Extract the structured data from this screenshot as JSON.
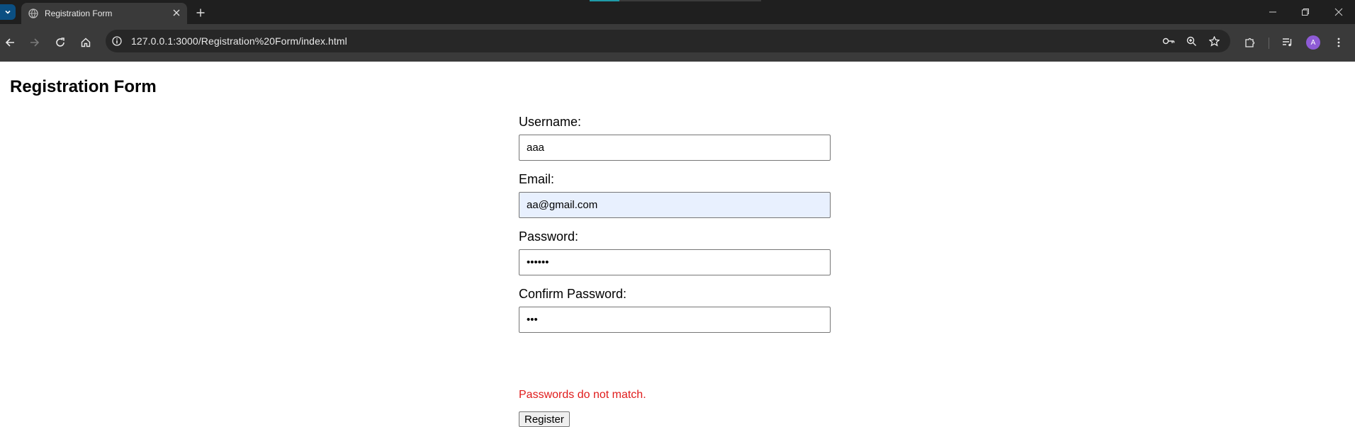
{
  "browser": {
    "tab_title": "Registration Form",
    "url": "127.0.0.1:3000/Registration%20Form/index.html",
    "profile_initial": "A"
  },
  "page": {
    "title": "Registration Form"
  },
  "form": {
    "username": {
      "label": "Username:",
      "value": "aaa"
    },
    "email": {
      "label": "Email:",
      "value": "aa@gmail.com"
    },
    "password": {
      "label": "Password:",
      "value": "••••••"
    },
    "confirm_password": {
      "label": "Confirm Password:",
      "value": "•••"
    },
    "error_message": "Passwords do not match.",
    "register_label": "Register"
  },
  "colors": {
    "error": "#e01b1b",
    "autofill_bg": "#e8f0fe",
    "avatar": "#8e5bd6"
  }
}
